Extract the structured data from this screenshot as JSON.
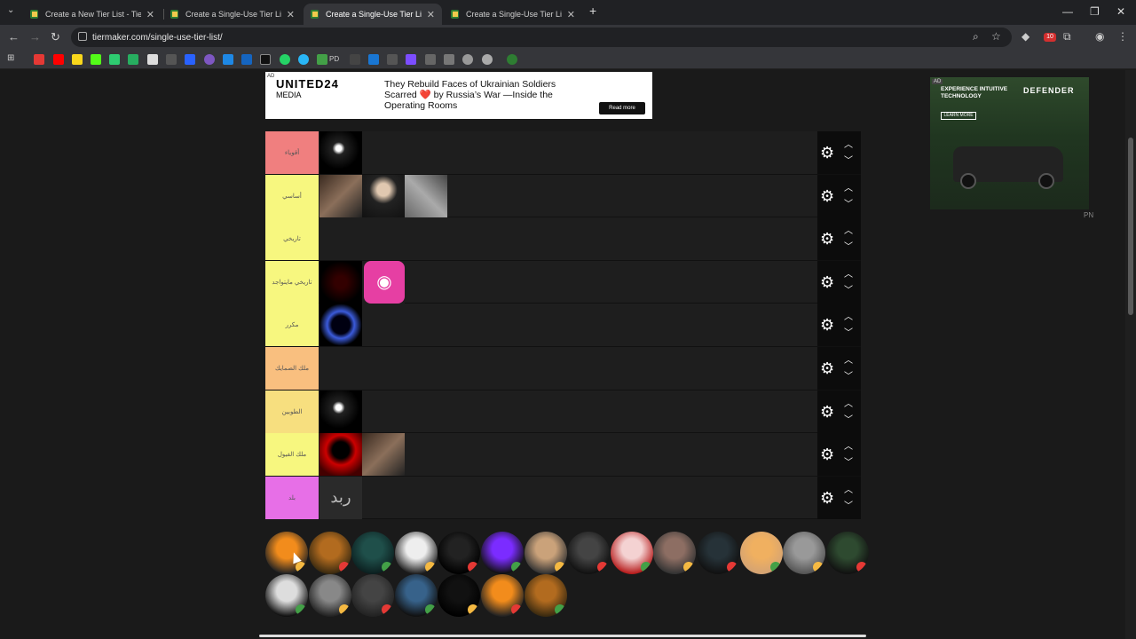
{
  "browser": {
    "tabs": [
      {
        "title": "Create a New Tier List - TierMaker"
      },
      {
        "title": "Create a Single-Use Tier List (Pe"
      },
      {
        "title": "Create a Single-Use Tier List (Pe"
      },
      {
        "title": "Create a Single-Use Tier List (Pe"
      }
    ],
    "active_tab_index": 2,
    "url": "tiermaker.com/single-use-tier-list/",
    "extension_badge": "10",
    "bookmark_label_pd": "PD"
  },
  "ads": {
    "top": {
      "ad_label": "AD",
      "brand_line1": "UNITED24",
      "brand_line2": "MEDIA",
      "headline": "They Rebuild Faces of Ukrainian Soldiers Scarred ❤️ by Russia’s War —Inside the Operating Rooms",
      "cta": "Read more"
    },
    "right": {
      "ad_label": "AD",
      "tagline": "EXPERIENCE INTUITIVE TECHNOLOGY",
      "brand": "DEFENDER",
      "cta": "LEARN MORE"
    },
    "pn_mark": "PN"
  },
  "tiers": [
    {
      "label": "أقوياء",
      "color": "#f07f7f",
      "items": 1
    },
    {
      "label": "أساسي",
      "color": "#f7f77f",
      "items": 3
    },
    {
      "label": "تاريخي",
      "color": "#f7f77f",
      "items": 0
    },
    {
      "label": "تاريخي مايتواجد",
      "color": "#f7f77f",
      "items": 2
    },
    {
      "label": "مكرر",
      "color": "#f7f77f",
      "items": 1
    },
    {
      "label": "ملك الصمايك",
      "color": "#f9bf7f",
      "items": 0
    },
    {
      "label": "الطوبين",
      "color": "#f7df7f",
      "items": 1
    },
    {
      "label": "ملك الفيول",
      "color": "#f7f77f",
      "items": 2
    },
    {
      "label": "بلد",
      "color": "#e76fe7",
      "items": 1
    }
  ],
  "tier_item_text": "ربد",
  "pool_count": 21
}
